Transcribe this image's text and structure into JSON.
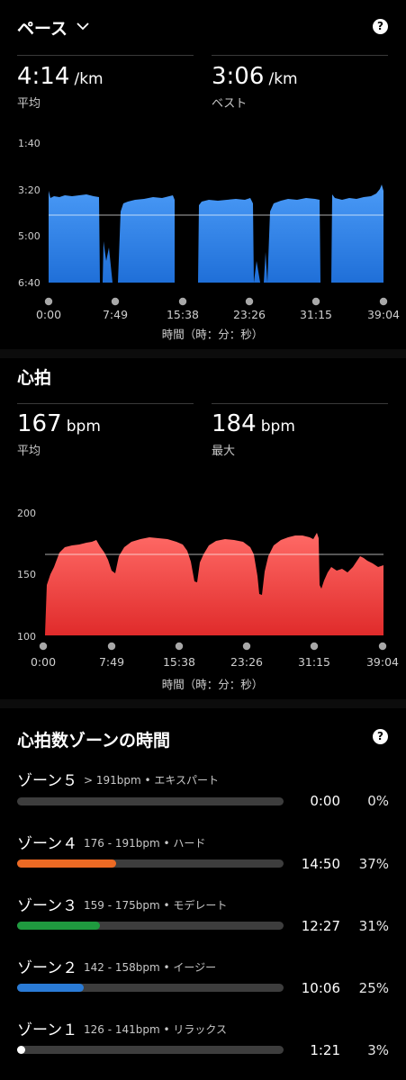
{
  "pace": {
    "title": "ペース",
    "avg_value": "4:14",
    "avg_unit": "/km",
    "avg_label": "平均",
    "best_value": "3:06",
    "best_unit": "/km",
    "best_label": "ベスト"
  },
  "pace_chart": {
    "type": "area",
    "y_ticks": [
      "1:40",
      "3:20",
      "5:00",
      "6:40"
    ],
    "x_ticks": [
      "0:00",
      "7:49",
      "15:38",
      "23:26",
      "31:15",
      "39:04"
    ],
    "xlabel": "時間（時：分：秒）",
    "color": "#3d8ff2"
  },
  "heart": {
    "title": "心拍",
    "avg_value": "167",
    "avg_unit": "bpm",
    "avg_label": "平均",
    "max_value": "184",
    "max_unit": "bpm",
    "max_label": "最大"
  },
  "hr_chart": {
    "type": "area",
    "y_ticks": [
      "200",
      "150",
      "100"
    ],
    "x_ticks": [
      "0:00",
      "7:49",
      "15:38",
      "23:26",
      "31:15",
      "39:04"
    ],
    "xlabel": "時間（時：分：秒）",
    "color": "#f0413f"
  },
  "zones": {
    "title": "心拍数ゾーンの時間",
    "items": [
      {
        "name": "ゾーン５",
        "range": "> 191bpm • エキスパート",
        "time": "0:00",
        "pct": "0%",
        "fraction": 0.0,
        "color": "#ffffff"
      },
      {
        "name": "ゾーン４",
        "range": "176 - 191bpm • ハード",
        "time": "14:50",
        "pct": "37%",
        "fraction": 0.37,
        "color": "#ec6a24"
      },
      {
        "name": "ゾーン３",
        "range": "159 - 175bpm • モデレート",
        "time": "12:27",
        "pct": "31%",
        "fraction": 0.31,
        "color": "#1f9a3f"
      },
      {
        "name": "ゾーン２",
        "range": "142 - 158bpm • イージー",
        "time": "10:06",
        "pct": "25%",
        "fraction": 0.25,
        "color": "#2a7bd6"
      },
      {
        "name": "ゾーン１",
        "range": "126 - 141bpm • リラックス",
        "time": "1:21",
        "pct": "3%",
        "fraction": 0.03,
        "color": "#ffffff"
      }
    ]
  }
}
